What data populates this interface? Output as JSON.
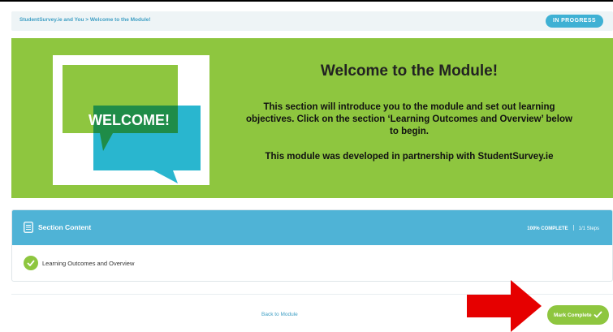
{
  "breadcrumb": {
    "parent": "StudentSurvey.ie and You",
    "separator": ">",
    "current": "Welcome to the Module!"
  },
  "status_badge": "IN PROGRESS",
  "hero": {
    "image_text": "WELCOME!",
    "title": "Welcome to the Module!",
    "intro": "This section will introduce you to the module and set out learning objectives.  Click on the section ‘Learning Outcomes and Overview’ below to begin.",
    "partner": "This module was developed in partnership with StudentSurvey.ie"
  },
  "section": {
    "title": "Section Content",
    "percent": "100% COMPLETE",
    "steps": "1/1 Steps",
    "lessons": [
      {
        "label": "Learning Outcomes and Overview",
        "status": "complete"
      }
    ]
  },
  "footer": {
    "back_label": "Back to Module",
    "mark_complete_label": "Mark Complete"
  },
  "colors": {
    "brand_green": "#8ec63f",
    "brand_blue": "#4fb3d6",
    "annotation_red": "#e60000"
  },
  "icons": {
    "section": "document-list-icon",
    "lesson": "check-circle-icon",
    "button": "checkmark-icon",
    "annotation": "red-arrow"
  }
}
